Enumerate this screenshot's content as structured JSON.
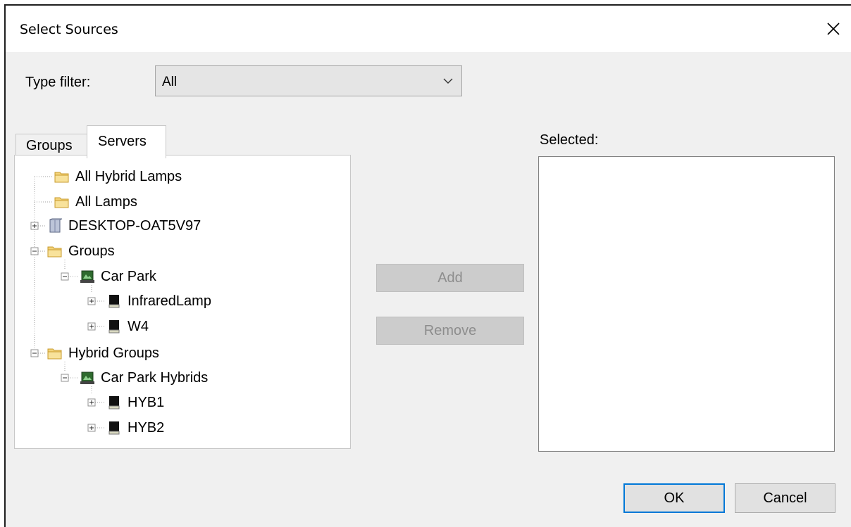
{
  "dialog": {
    "title": "Select Sources"
  },
  "filter": {
    "label": "Type filter:",
    "value": "All"
  },
  "tabs": [
    {
      "label": "Groups",
      "active": false
    },
    {
      "label": "Servers",
      "active": true
    }
  ],
  "tree": {
    "items": [
      {
        "label": "All Hybrid Lamps",
        "icon": "folder-icon"
      },
      {
        "label": "All Lamps",
        "icon": "folder-icon"
      },
      {
        "label": "DESKTOP-OAT5V97",
        "icon": "server-icon",
        "expander": "plus"
      },
      {
        "label": "Groups",
        "icon": "folder-icon",
        "expander": "minus"
      },
      {
        "label": "Car Park",
        "icon": "group-icon",
        "expander": "minus"
      },
      {
        "label": "InfraredLamp",
        "icon": "lamp-icon",
        "expander": "plus"
      },
      {
        "label": "W4",
        "icon": "lamp-icon",
        "expander": "plus"
      },
      {
        "label": "Hybrid Groups",
        "icon": "folder-icon",
        "expander": "minus"
      },
      {
        "label": "Car Park Hybrids",
        "icon": "group-icon",
        "expander": "minus"
      },
      {
        "label": "HYB1",
        "icon": "lamp-icon",
        "expander": "plus"
      },
      {
        "label": "HYB2",
        "icon": "lamp-icon",
        "expander": "plus"
      }
    ]
  },
  "actions": {
    "add": "Add",
    "remove": "Remove"
  },
  "selected": {
    "label": "Selected:",
    "items": []
  },
  "footer": {
    "ok": "OK",
    "cancel": "Cancel"
  },
  "colors": {
    "focus_border": "#0078d7",
    "dialog_bg": "#f0f0f0"
  }
}
